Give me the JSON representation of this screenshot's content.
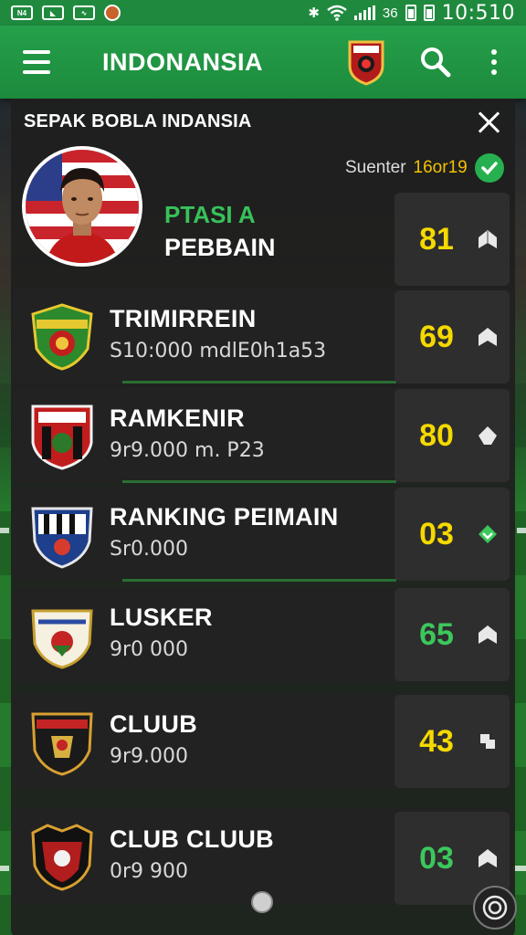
{
  "status_bar": {
    "left_icons": [
      "N4",
      "sim-icon",
      "wave-icon",
      "app-icon"
    ],
    "network_label": "36",
    "time": "10:510"
  },
  "app_bar": {
    "title": "INDONANSIA",
    "icons": [
      "menu-icon",
      "club-crest-icon",
      "search-icon",
      "more-icon"
    ]
  },
  "panel": {
    "title": "SEPAK BOBLA INDANSIA",
    "subscribe_prefix": "Suenter",
    "subscribe_highlight": "16or19",
    "featured": {
      "line1": "PTASI A",
      "line2": "PEBBAIN",
      "score": "81",
      "score_color": "#f5d900"
    }
  },
  "rows": [
    {
      "name": "TRIMIRREIN",
      "sub": "S10:000 mdlE0h1a53",
      "score": "69",
      "score_color": "#f5d900"
    },
    {
      "name": "RAMKENIR",
      "sub": "9r9.000 m. P23",
      "score": "80",
      "score_color": "#f5d900"
    },
    {
      "name": "RANKING PEIMAIN",
      "sub": "Sr0.000",
      "score": "03",
      "score_color": "#f5d900"
    },
    {
      "name": "LUSKER",
      "sub": "9r0 000",
      "score": "65",
      "score_color": "#3cc75c"
    },
    {
      "name": "CLUUB",
      "sub": "9r9.000",
      "score": "43",
      "score_color": "#f5d900"
    },
    {
      "name": "CLUB CLUUB",
      "sub": "0r9 900",
      "score": "03",
      "score_color": "#3cc75c"
    }
  ],
  "colors": {
    "app_bar": "#1f8a3e",
    "panel_bg": "#1e1e1e",
    "yellow_score": "#f5d900",
    "green_score": "#3cc75c"
  }
}
